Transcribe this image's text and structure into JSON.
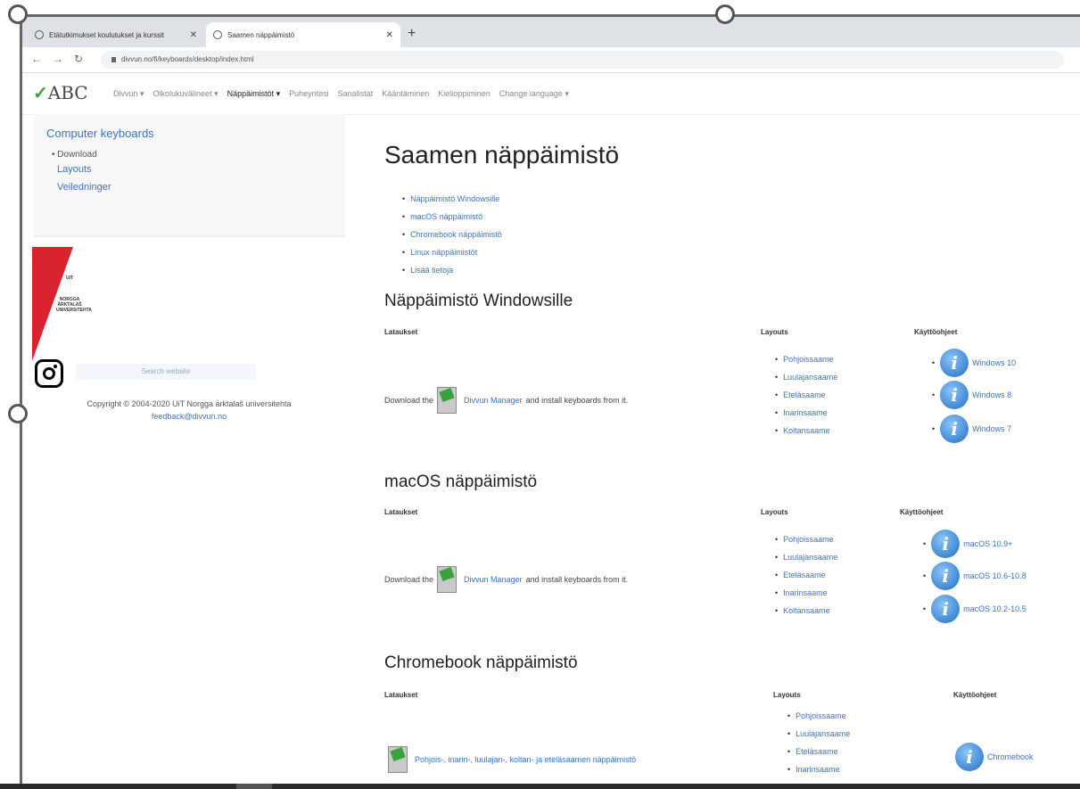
{
  "browser": {
    "tabs": [
      {
        "title": "Etätutkimukset koulutukset ja kurssit"
      },
      {
        "title": "Saamen näppäimistö"
      }
    ],
    "new_tab": "+",
    "url": "divvun.no/fi/keyboards/desktop/index.html"
  },
  "site": {
    "logo": "ABC",
    "nav": [
      {
        "label": "Divvun ▾"
      },
      {
        "label": "Oikolukuvälineet ▾"
      },
      {
        "label": "Näppäimistöt ▾",
        "active": true
      },
      {
        "label": "Puheyntesi"
      },
      {
        "label": "Sanalistat"
      },
      {
        "label": "Kääntäminen"
      },
      {
        "label": "Kielioppiminen"
      },
      {
        "label": "Change language ▾"
      }
    ]
  },
  "sidebar": {
    "title": "Computer keyboards",
    "download": "Download",
    "links": [
      "Layouts",
      "Veiledninger"
    ],
    "search_placeholder": "Search website",
    "copyright": "Copyright © 2004-2020 UiT Norgga árktalaš universitehta",
    "feedback": "feedback@divvun.no"
  },
  "main": {
    "title": "Saamen näppäimistö",
    "toc": [
      "Näppäimistö Windowsille",
      "macOS näppäimistö",
      "Chromebook näppäimistö",
      "Linux näppäimistöt",
      "Lisää tietoja"
    ],
    "col_downloads": "Lataukset",
    "col_layouts": "Layouts",
    "col_guides": "Käyttöohjeet",
    "download_prefix": "Download the",
    "manager": "Divvun Manager",
    "download_suffix": "and install keyboards from it.",
    "layout_names": [
      "Pohjoissaame",
      "Luulajansaame",
      "Eteläsaame",
      "Inarinsaame",
      "Koltansaame"
    ],
    "windows": {
      "heading": "Näppäimistö Windowsille",
      "guides": [
        "Windows 10",
        "Windows 8",
        "Windows 7"
      ]
    },
    "macos": {
      "heading": "macOS näppäimistö",
      "guides": [
        "macOS 10.9+",
        "macOS 10.6-10.8",
        "macOS 10.2-10.5"
      ]
    },
    "chromebook": {
      "heading": "Chromebook näppäimistö",
      "download": "Pohjois-, inarin-, luulajan-, koltan- ja eteläsaamen näppäimistö",
      "guides": [
        "Chromebook"
      ]
    }
  },
  "colors": {
    "link": "#3a72c4",
    "accent_red": "#d9232e",
    "green": "#3aa23a"
  }
}
